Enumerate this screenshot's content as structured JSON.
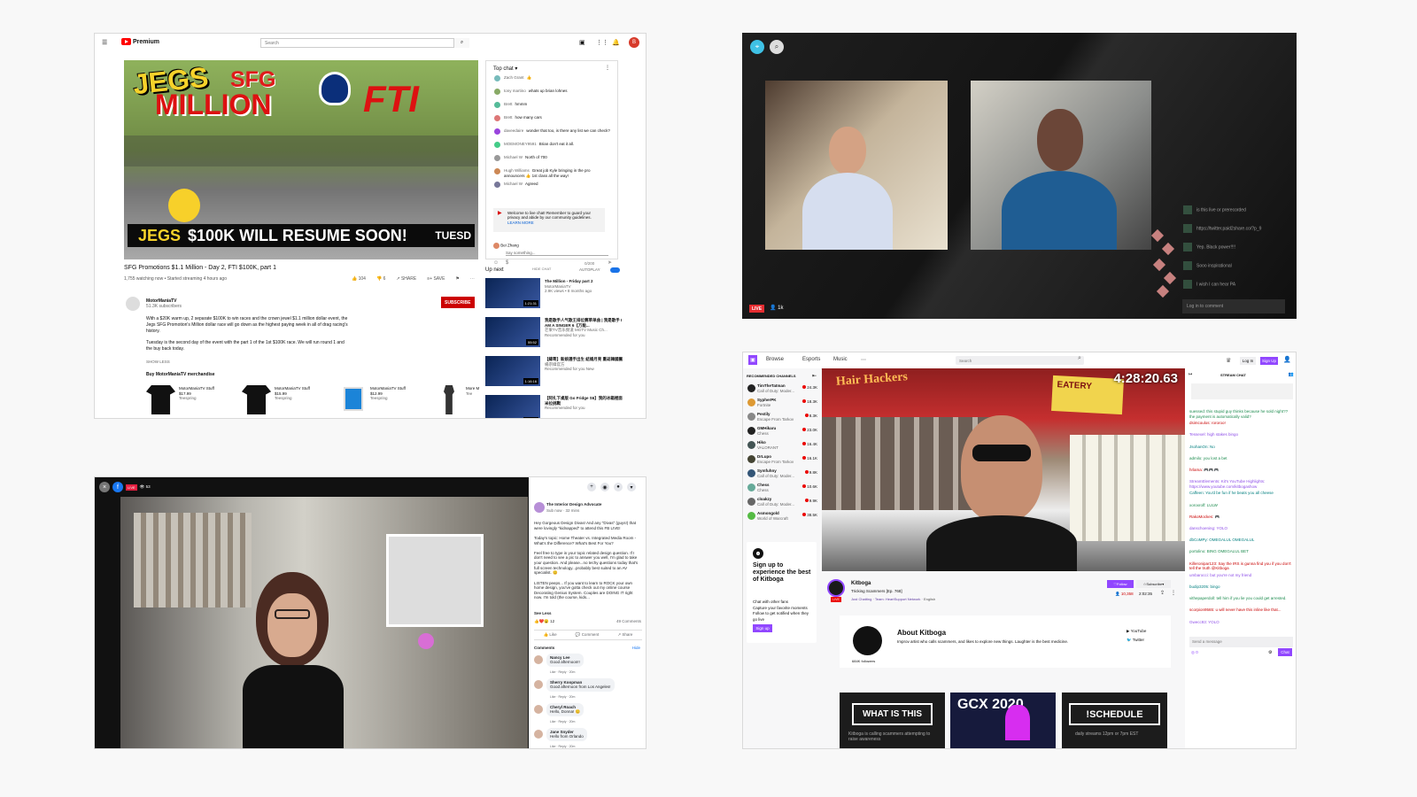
{
  "youtube": {
    "brand": "Premium",
    "search_placeholder": "Search",
    "video_overlay": {
      "jegs": "JEGS",
      "million": "MILLION",
      "sfg": "SFG",
      "fti": "FTI",
      "resume": "$100K WILL RESUME SOON!",
      "tuesday": "TUESD"
    },
    "chat_header": "Top chat ▾",
    "chat_messages": [
      {
        "name": "Zach Grant",
        "text": "👍"
      },
      {
        "name": "tony martino",
        "text": "whats up brian lohnes"
      },
      {
        "name": "Brett",
        "text": "hmmm"
      },
      {
        "name": "Brett",
        "text": "how many cars"
      },
      {
        "name": "daveedaire",
        "text": "wonder that too, is there any list we can check?"
      },
      {
        "name": "MOEMONEY9591",
        "text": "Brian don't eat it all."
      },
      {
        "name": "Michael W",
        "text": "North of 700"
      },
      {
        "name": "Hugh Williams",
        "text": "Great job Kyle bringing in the pro announcers 👍 1st class all the way!"
      },
      {
        "name": "Michael W",
        "text": "Agreed"
      }
    ],
    "chat_notice": "Welcome to live chat! Remember to guard your privacy and abide by our community guidelines.",
    "learn_more": "LEARN MORE",
    "chat_user": "Bei Zhang",
    "chat_placeholder": "Say something...",
    "chat_count": "0/200",
    "hide_chat": "HIDE CHAT",
    "video_title": "SFG Promotions $1.1 Million - Day 2, FTI $100K, part 1",
    "video_meta": "1,755 watching now • Started streaming 4 hours ago",
    "likes": "104",
    "dislikes": "6",
    "share": "SHARE",
    "save": "SAVE",
    "channel": "MotorManiaTV",
    "subscribers": "51.3K subscribers",
    "subscribe": "SUBSCRIBE",
    "description_1": "With a $20K warm up, 2 separate $100K to win races and the crown jewel $1.1 million dollar event, the Jegs SFG Promotion's Million dollar race will go down as the highest paying week in all of drag racing's history.",
    "description_2": "Tuesday is the second day of the event with the part 1 of the 1st $100K race. We will run round 1 and the buy back today.",
    "show_less": "SHOW LESS",
    "merch_title": "Buy MotorManiaTV merchandise",
    "merch": [
      {
        "name": "MotorManiaTV Stuff",
        "price": "$17.99",
        "seller": "Teespring"
      },
      {
        "name": "MotorManiaTV Stuff",
        "price": "$15.99",
        "seller": "Teespring"
      },
      {
        "name": "MotorManiaTV Stuff",
        "price": "$12.99",
        "seller": "Teespring"
      },
      {
        "name": "More M",
        "price": "",
        "seller": "Tee"
      }
    ],
    "up_next": "Up next",
    "autoplay": "AUTOPLAY",
    "recommendations": [
      {
        "title": "The Million - Friday part 2",
        "channel": "MotorManiaTV",
        "meta": "2.9K views • 8 months ago",
        "time": "1:21:31"
      },
      {
        "title": "我是歌手人气歌王排位赛草单曲 | 我是歌手 I AM A SINGER 6【万能...",
        "channel": "芒果TV音乐频道 MGTV Music Ch...",
        "meta": "Recommended for you",
        "time": "55:52"
      },
      {
        "title": "【緯哥】新娘選手出生 結婚月亮 重返韓國團",
        "channel": "楊宗緯官方",
        "meta": "Recommended for you\nNew",
        "time": "1:16:16"
      },
      {
        "title": "【阿扎下桌版 Go Fridge S6】我的冰箱裡面 米拉挑戰",
        "channel": "",
        "meta": "Recommended for you",
        "time": "1:29:28"
      }
    ]
  },
  "periscope": {
    "live": "LIVE",
    "viewers": "1k",
    "comments": [
      "is this live or prerecorded",
      "https://twitter.paid2share.co/?p_9",
      "Yep. Black power!!!!",
      "Sooo inspirational",
      "I wish I can hear PA"
    ],
    "comment_placeholder": "Log in to comment"
  },
  "facebook": {
    "live": "LIVE",
    "views": "53",
    "page_name": "The Interior Design Advocate",
    "status": "Sub now · 32 mins",
    "post": [
      "Hey Gorgeous Design Divas! And any \"Divas\" (guys!) that were lovingly \"kidnapped\" to attend this FB LIVE!",
      "Today's topic: Home Theater vs. Integrated Media Room - What's the Difference? What's Best For You?",
      "Feel free to type in your topic related design question. If I don't need to see a pic to answer you well, I'm glad to take your question. And please...no techy questions today that's full screen technology...probably best suited to an AV specialist. 😊",
      "LISTEN peeps... If you want to learn to ROCK your own home design, you've gotta check out my online course Decorating Genius System. Couples are DOING IT right now. I'm told (the course, kids..."
    ],
    "see_less": "See Less",
    "reactions": "12",
    "comments_count": "49 Comments",
    "like": "Like",
    "comment": "Comment",
    "share": "Share",
    "comments_label": "Comments",
    "hide": "Hide",
    "comment_items": [
      {
        "name": "Nancy Lee",
        "text": "Good afternoon!!"
      },
      {
        "name": "Sherry Koopman",
        "text": "Good afternoon from Los Angeles!"
      },
      {
        "name": "Cheryl Roach",
        "text": "Hello, Donna! 😊"
      },
      {
        "name": "Jane Snyder",
        "text": "Hello from Orlando"
      }
    ],
    "comment_meta": "Like · Reply · 20m"
  },
  "twitch": {
    "nav": [
      "Browse",
      "Esports",
      "Music",
      "⋯"
    ],
    "search": "Search",
    "log_in": "Log In",
    "sign_up": "Sign Up",
    "recommended": "RECOMMENDED CHANNELS",
    "channels": [
      {
        "name": "TimTheTatman",
        "game": "Call of Duty: Moder...",
        "count": "24.3K"
      },
      {
        "name": "SypherPK",
        "game": "Fortnite",
        "count": "18.3K"
      },
      {
        "name": "Pestily",
        "game": "Escape From Tarkov",
        "count": "8.3K"
      },
      {
        "name": "GMHikaru",
        "game": "Chess",
        "count": "23.0K"
      },
      {
        "name": "Hiko",
        "game": "VALORANT",
        "count": "16.4K"
      },
      {
        "name": "DrLupo",
        "game": "Escape From Tarkov",
        "count": "16.1K"
      },
      {
        "name": "Symfuhny",
        "game": "Call of Duty: Moder...",
        "count": "9.8K"
      },
      {
        "name": "Chess",
        "game": "Chess",
        "count": "10.6K"
      },
      {
        "name": "cloakzy",
        "game": "Call of Duty: Moder...",
        "count": "9.9K"
      },
      {
        "name": "Asmongold",
        "game": "World of Warcraft",
        "count": "38.5K"
      }
    ],
    "signup_title": "Sign up to experience the best of Kitboga",
    "signup_brand": "Kitboga",
    "signup_lines": [
      "Chat with other fans",
      "Capture your favorite moments",
      "Follow to get notified when they go live"
    ],
    "signup_button": "Sign up",
    "timer": "4:28:20.63",
    "streamer": "Kitboga",
    "stream_title": "Tricking Scammers [Ep. 768]",
    "category": "Just Chatting",
    "team": "Team: HeartSupport Network",
    "language": "English",
    "follow": "Follow",
    "subscribe": "Subscribe",
    "viewers": "10,358",
    "uptime": "2:02:35",
    "about": "About Kitboga",
    "about_desc": "Improv artist who calls scammers, and likes to explore new things. Laughter is the best medicine.",
    "followers": "684K followers",
    "social": [
      "YouTube",
      "Twitter"
    ],
    "cards": [
      "WHAT IS THIS",
      "GCX 2020",
      "!SCHEDULE"
    ],
    "schedule_sub": "daily streams 12pm or 7pm EST",
    "what_sub": "Kitboga is calling scammers attempting to raise awareness",
    "stream_chat": "STREAM CHAT",
    "chat_lines": [
      "suessed: this stupid guy thinks because he sold night?? the payment is automatically valid?",
      "dsimcoulos: rororoo!",
      "Tessexel: high stakes bingo",
      "JsohanOn: No",
      "admilo: you lost a bet",
      "hrlama: 🎮🎮🎮",
      "StreamElements: Kit's YouTube Highlights: https://www.youtube.com/kitbogashow",
      "Caffeen: You'd be fun if he beats you all cheese",
      "xoroxrolf: LULW",
      "RakoMockes: 🎮",
      "danschoening: YOLO",
      "dbCoMPy: OMEGALUL OMEGALUL",
      "portolino: BING OMEGALUL BET",
      "Killeronipar123: Say the IRS is gunna find you if you don't tell the truth @Kitboga",
      "umbarocci: but you're not my friend",
      "budip3205: bingo",
      "vithepaperdoll: tell him if you lie you could get arrested.",
      "scorpion9565: u will never have this inline like that...",
      "Gwecc93: YOLO"
    ],
    "send_placeholder": "Send a message",
    "points": "0",
    "chat_button": "Chat"
  }
}
